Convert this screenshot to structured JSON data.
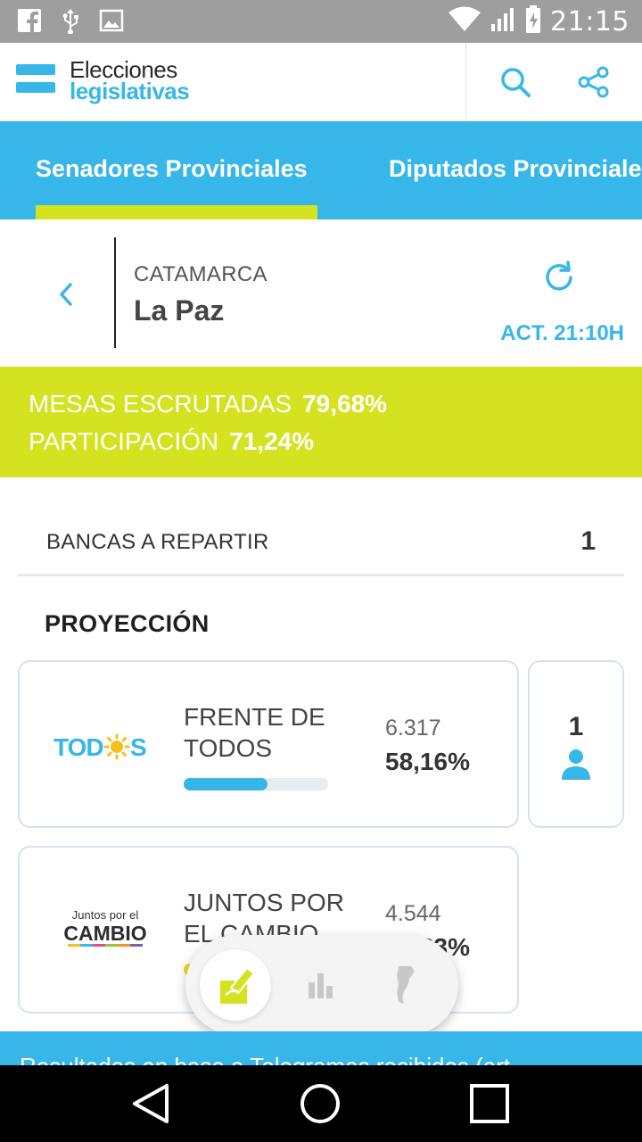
{
  "status_bar": {
    "time": "21:15",
    "left_icons": [
      "facebook-icon",
      "usb-icon",
      "image-icon"
    ],
    "right_icons": [
      "wifi-icon",
      "signal-icon",
      "battery-charging-icon"
    ]
  },
  "header": {
    "logo_line1": "Elecciones",
    "logo_line2": "legislativas",
    "actions": [
      "search-icon",
      "share-icon"
    ]
  },
  "tabs": [
    {
      "label": "Senadores Provinciales",
      "active": true
    },
    {
      "label": "Diputados Provinciales",
      "active": false
    }
  ],
  "location": {
    "province": "CATAMARCA",
    "district": "La Paz",
    "updated": "ACT. 21:10H"
  },
  "stats": {
    "mesas_label": "MESAS ESCRUTADAS",
    "mesas_value": "79,68%",
    "participacion_label": "PARTICIPACIÓN",
    "participacion_value": "71,24%"
  },
  "bancas": {
    "label": "BANCAS A REPARTIR",
    "value": "1"
  },
  "proyeccion_title": "PROYECCIÓN",
  "parties": [
    {
      "logo_text": "TOD S",
      "logo_top": "",
      "name": "FRENTE DE TODOS",
      "votes": "6.317",
      "percent": "58,16%",
      "bar_fraction": 0.58,
      "seats": "1"
    },
    {
      "logo_text": "CAMBIO",
      "logo_top": "Juntos por el",
      "name": "JUNTOS POR EL CAMBIO",
      "votes": "4.544",
      "percent": "41,83%",
      "bar_fraction": 0.42
    }
  ],
  "floating_nav": [
    "vote-ballot-icon",
    "bar-chart-icon",
    "argentina-map-icon"
  ],
  "footer_text": "Resultados en base a Telegramas recibidos (art.",
  "colors": {
    "primary_blue": "#37b6e9",
    "accent_green": "#d4e21f"
  }
}
